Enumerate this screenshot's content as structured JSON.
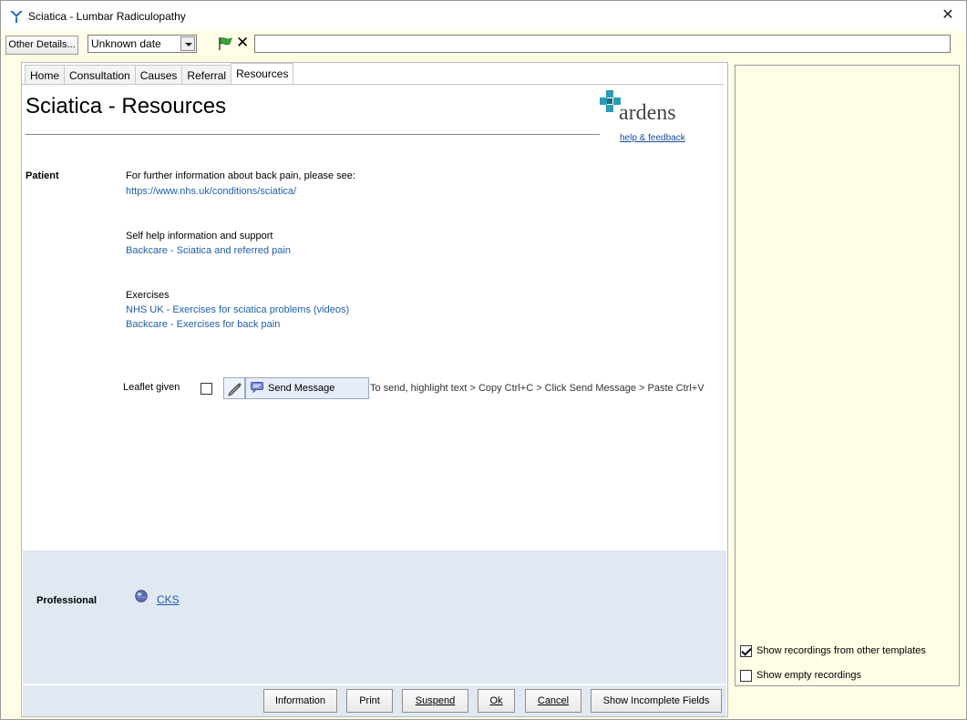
{
  "window": {
    "title": "Sciatica - Lumbar Radiculopathy",
    "close_glyph": "✕"
  },
  "toolbar": {
    "other_details_label": "Other Details...",
    "date_value": "Unknown date",
    "clear_glyph": "✕",
    "note_value": ""
  },
  "tabs": [
    {
      "label": "Home"
    },
    {
      "label": "Consultation"
    },
    {
      "label": "Causes"
    },
    {
      "label": "Referral"
    },
    {
      "label": "Resources",
      "active": true
    }
  ],
  "page": {
    "title": "Sciatica - Resources",
    "logo_text": "ardens",
    "help_link": "help & feedback"
  },
  "patient": {
    "label": "Patient",
    "further_info_text": "For further information about back pain, please see:",
    "nhs_link": "https://www.nhs.uk/conditions/sciatica/",
    "self_help_heading": "Self help information and support",
    "backcare_sciatica_link": "Backcare - Sciatica and referred pain",
    "exercises_heading": "Exercises",
    "nhs_exercises_link": "NHS UK - Exercises for sciatica problems (videos)",
    "backcare_exercises_link": "Backcare - Exercises for back pain",
    "leaflet_label": "Leaflet given",
    "send_message_label": "Send Message",
    "send_instructions": "To send, highlight text > Copy Ctrl+C > Click Send Message > Paste Ctrl+V"
  },
  "professional": {
    "label": "Professional",
    "cks_link": "CKS"
  },
  "footer": {
    "information": "Information",
    "print": "Print",
    "suspend": "Suspend",
    "ok": "Ok",
    "cancel": "Cancel",
    "show_incomplete": "Show Incomplete Fields"
  },
  "side_panel": {
    "show_other_templates": "Show recordings from other templates",
    "show_other_templates_checked": true,
    "show_empty": "Show empty recordings",
    "show_empty_checked": false
  },
  "colors": {
    "accent_teal": "#2a9bb5",
    "link_blue": "#1f5fa8",
    "side_bg": "#fffde6",
    "professional_bg": "#e0e8f2"
  }
}
